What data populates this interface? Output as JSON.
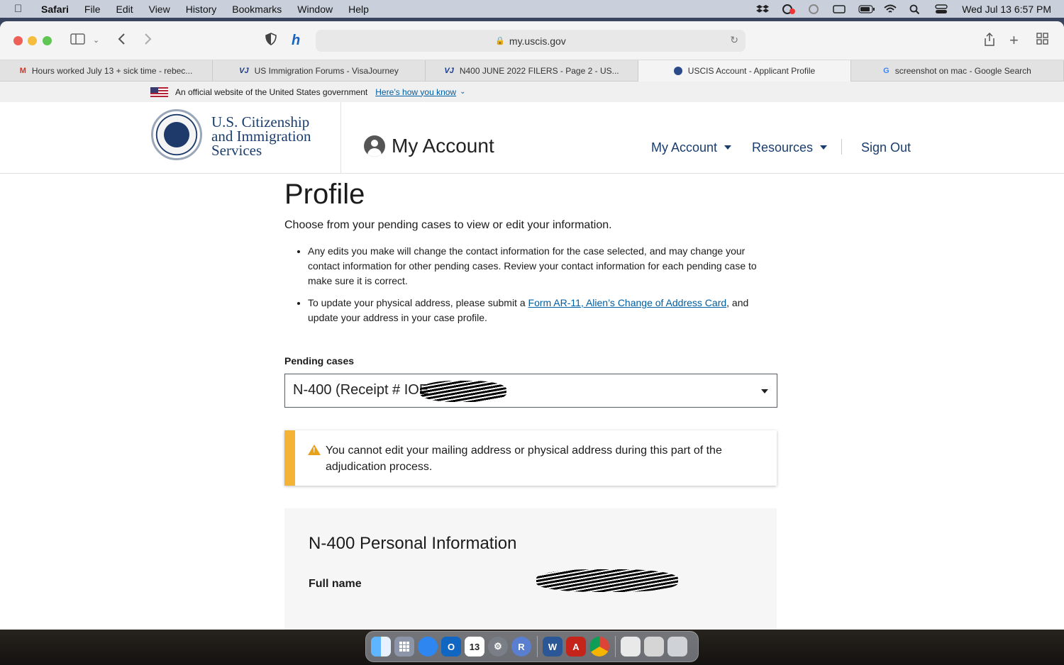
{
  "menubar": {
    "app": "Safari",
    "items": [
      "File",
      "Edit",
      "View",
      "History",
      "Bookmarks",
      "Window",
      "Help"
    ],
    "clock": "Wed Jul 13  6:57 PM"
  },
  "browser": {
    "url": "my.uscis.gov",
    "tabs": [
      {
        "favicon": "M",
        "title": "Hours worked July 13 + sick time - rebec..."
      },
      {
        "favicon": "VJ",
        "title": "US Immigration Forums - VisaJourney"
      },
      {
        "favicon": "VJ",
        "title": "N400 JUNE 2022 FILERS - Page 2 - US..."
      },
      {
        "favicon": "",
        "title": "USCIS Account - Applicant Profile"
      },
      {
        "favicon": "G",
        "title": "screenshot on mac - Google Search"
      }
    ]
  },
  "gov_banner": {
    "text": "An official website of the United States government",
    "link": "Here’s how you know"
  },
  "header": {
    "agency_line1": "U.S. Citizenship",
    "agency_line2": "and Immigration",
    "agency_line3": "Services",
    "account_title": "My Account",
    "nav": {
      "my_account": "My Account",
      "resources": "Resources",
      "sign_out": "Sign Out"
    }
  },
  "main": {
    "title": "Profile",
    "intro": "Choose from your pending cases to view or edit your information.",
    "bullet1": "Any edits you make will change the contact information for the case selected, and may change your contact information for other pending cases. Review your contact information for each pending case to make sure it is correct.",
    "bullet2_before": "To update your physical address, please submit a ",
    "bullet2_link": "Form AR-11, Alien’s Change of Address Card",
    "bullet2_after": ", and update your address in your case profile.",
    "pending_label": "Pending cases",
    "pending_value": "N-400 (Receipt # IOE",
    "alert": "You cannot edit your mailing address or physical address during this part of the adjudication process.",
    "card_title": "N-400 Personal Information",
    "full_name_label": "Full name"
  },
  "colors": {
    "uscis_blue": "#1a3d6e",
    "link_blue": "#005ea2",
    "warning": "#f5b335"
  }
}
